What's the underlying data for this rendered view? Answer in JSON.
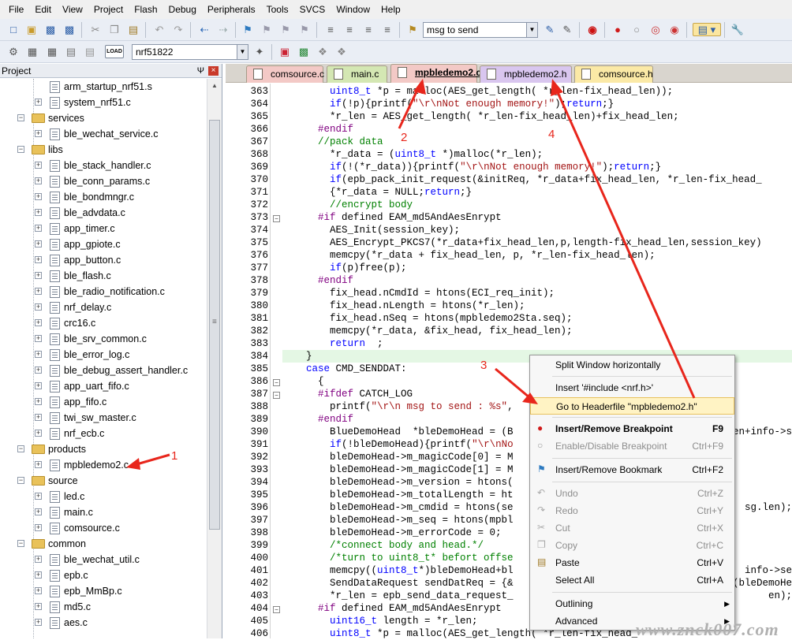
{
  "menu": [
    "File",
    "Edit",
    "View",
    "Project",
    "Flash",
    "Debug",
    "Peripherals",
    "Tools",
    "SVCS",
    "Window",
    "Help"
  ],
  "toolbar": {
    "find_combo_value": "msg to send",
    "target_combo_value": "nrf51822",
    "load_label": "LOAD"
  },
  "project_panel": {
    "title": "Project",
    "pin_glyph": "Ψ",
    "close_glyph": "×",
    "items": [
      {
        "label": "arm_startup_nrf51.s",
        "type": "file",
        "level": 2,
        "expand": ""
      },
      {
        "label": "system_nrf51.c",
        "type": "file",
        "level": 2,
        "expand": "+"
      },
      {
        "label": "services",
        "type": "folder",
        "level": 1,
        "expand": "−"
      },
      {
        "label": "ble_wechat_service.c",
        "type": "file",
        "level": 2,
        "expand": "+"
      },
      {
        "label": "libs",
        "type": "folder",
        "level": 1,
        "expand": "−"
      },
      {
        "label": "ble_stack_handler.c",
        "type": "file",
        "level": 2,
        "expand": "+"
      },
      {
        "label": "ble_conn_params.c",
        "type": "file",
        "level": 2,
        "expand": "+"
      },
      {
        "label": "ble_bondmngr.c",
        "type": "file",
        "level": 2,
        "expand": "+"
      },
      {
        "label": "ble_advdata.c",
        "type": "file",
        "level": 2,
        "expand": "+"
      },
      {
        "label": "app_timer.c",
        "type": "file",
        "level": 2,
        "expand": "+"
      },
      {
        "label": "app_gpiote.c",
        "type": "file",
        "level": 2,
        "expand": "+"
      },
      {
        "label": "app_button.c",
        "type": "file",
        "level": 2,
        "expand": "+"
      },
      {
        "label": "ble_flash.c",
        "type": "file",
        "level": 2,
        "expand": "+"
      },
      {
        "label": "ble_radio_notification.c",
        "type": "file",
        "level": 2,
        "expand": "+"
      },
      {
        "label": "nrf_delay.c",
        "type": "file",
        "level": 2,
        "expand": "+"
      },
      {
        "label": "crc16.c",
        "type": "file",
        "level": 2,
        "expand": "+"
      },
      {
        "label": "ble_srv_common.c",
        "type": "file",
        "level": 2,
        "expand": "+"
      },
      {
        "label": "ble_error_log.c",
        "type": "file",
        "level": 2,
        "expand": "+"
      },
      {
        "label": "ble_debug_assert_handler.c",
        "type": "file",
        "level": 2,
        "expand": "+"
      },
      {
        "label": "app_uart_fifo.c",
        "type": "file",
        "level": 2,
        "expand": "+"
      },
      {
        "label": "app_fifo.c",
        "type": "file",
        "level": 2,
        "expand": "+"
      },
      {
        "label": "twi_sw_master.c",
        "type": "file",
        "level": 2,
        "expand": "+"
      },
      {
        "label": "nrf_ecb.c",
        "type": "file",
        "level": 2,
        "expand": "+"
      },
      {
        "label": "products",
        "type": "folder",
        "level": 1,
        "expand": "−"
      },
      {
        "label": "mpbledemo2.c",
        "type": "file",
        "level": 2,
        "expand": "+"
      },
      {
        "label": "source",
        "type": "folder",
        "level": 1,
        "expand": "−"
      },
      {
        "label": "led.c",
        "type": "file",
        "level": 2,
        "expand": "+"
      },
      {
        "label": "main.c",
        "type": "file",
        "level": 2,
        "expand": "+"
      },
      {
        "label": "comsource.c",
        "type": "file",
        "level": 2,
        "expand": "+"
      },
      {
        "label": "common",
        "type": "folder",
        "level": 1,
        "expand": "−"
      },
      {
        "label": "ble_wechat_util.c",
        "type": "file",
        "level": 2,
        "expand": "+"
      },
      {
        "label": "epb.c",
        "type": "file",
        "level": 2,
        "expand": "+"
      },
      {
        "label": "epb_MmBp.c",
        "type": "file",
        "level": 2,
        "expand": "+"
      },
      {
        "label": "md5.c",
        "type": "file",
        "level": 2,
        "expand": "+"
      },
      {
        "label": "aes.c",
        "type": "file",
        "level": 2,
        "expand": "+"
      }
    ]
  },
  "tabs": [
    {
      "label": "comsource.c",
      "color": "#f3c9c6",
      "active": false
    },
    {
      "label": "main.c",
      "color": "#d4e7b3",
      "active": false
    },
    {
      "label": "mpbledemo2.c",
      "color": "#f3c9c6",
      "active": true
    },
    {
      "label": "mpbledemo2.h",
      "color": "#d9c6ef",
      "active": false
    },
    {
      "label": "comsource.h",
      "color": "#fbe9a6",
      "active": false
    }
  ],
  "code": {
    "line_numbers": [
      "363",
      "364",
      "365",
      "366",
      "367",
      "368",
      "369",
      "370",
      "371",
      "372",
      "373",
      "374",
      "375",
      "376",
      "377",
      "378",
      "379",
      "380",
      "381",
      "382",
      "383",
      "384",
      "385",
      "386",
      "387",
      "388",
      "389",
      "390",
      "391",
      "392",
      "393",
      "394",
      "395",
      "396",
      "397",
      "398",
      "399",
      "400",
      "401",
      "402",
      "403",
      "404",
      "405",
      "406"
    ],
    "lines": [
      "        uint8_t *p = malloc(AES_get_length( *r_len-fix_head_len));",
      "        if(!p){printf(\"\\r\\nNot enough memory!\");return;}",
      "        *r_len = AES_get_length( *r_len-fix_head_len)+fix_head_len;",
      "      #endif",
      "      //pack data",
      "        *r_data = (uint8_t *)malloc(*r_len);",
      "        if(!(*r_data)){printf(\"\\r\\nNot enough memory!\");return;}",
      "        if(epb_pack_init_request(&initReq, *r_data+fix_head_len, *r_len-fix_head_",
      "        {*r_data = NULL;return;}",
      "        //encrypt body",
      "      #if defined EAM_md5AndAesEnrypt",
      "        AES_Init(session_key);",
      "        AES_Encrypt_PKCS7(*r_data+fix_head_len,p,length-fix_head_len,session_key)",
      "        memcpy(*r_data + fix_head_len, p, *r_len-fix_head_len);",
      "        if(p)free(p);",
      "      #endif",
      "        fix_head.nCmdId = htons(ECI_req_init);",
      "        fix_head.nLength = htons(*r_len);",
      "        fix_head.nSeq = htons(mpbledemo2Sta.seq);",
      "        memcpy(*r_data, &fix_head, fix_head_len);",
      "        return  ;",
      "    }",
      "    case CMD_SENDDAT:",
      "      {",
      "      #ifdef CATCH_LOG",
      "        printf(\"\\r\\n msg to send : %s\",",
      "      #endif",
      "        BlueDemoHead  *bleDemoHead = (B",
      "        if(!bleDemoHead){printf(\"\\r\\nNo",
      "        bleDemoHead->m_magicCode[0] = M",
      "        bleDemoHead->m_magicCode[1] = M",
      "        bleDemoHead->m_version = htons(",
      "        bleDemoHead->m_totalLength = ht",
      "        bleDemoHead->m_cmdid = htons(se",
      "        bleDemoHead->m_seq = htons(mpbl",
      "        bleDemoHead->m_errorCode = 0;",
      "        /*connect body and head.*/",
      "        /*turn to uint8_t* befort offse",
      "        memcpy((uint8_t*)bleDemoHead+bl",
      "        SendDataRequest sendDatReq = {&",
      "        *r_len = epb_send_data_request_",
      "      #if defined EAM_md5AndAesEnrypt",
      "        uint16_t length = *r_len;",
      "        uint8_t *p = malloc(AES_get_length( *r_len-fix_head_"
    ],
    "right_fragments": [
      {
        "line_index": 27,
        "text": "en+info->s"
      },
      {
        "line_index": 33,
        "text": "sg.len);"
      },
      {
        "line_index": 38,
        "text": "info->se"
      },
      {
        "line_index": 39,
        "text": "(bleDemoHe"
      },
      {
        "line_index": 40,
        "text": "en);"
      }
    ]
  },
  "context_menu": {
    "items": [
      {
        "label": "Split Window horizontally",
        "shortcut": "",
        "state": "normal",
        "icon": ""
      },
      {
        "label": "Insert '#include <nrf.h>'",
        "shortcut": "",
        "state": "normal",
        "icon": ""
      },
      {
        "label": "Go to Headerfile \"mpbledemo2.h\"",
        "shortcut": "",
        "state": "selected",
        "icon": ""
      },
      {
        "label": "Insert/Remove Breakpoint",
        "shortcut": "F9",
        "state": "bold",
        "icon": "breakpoint-icon"
      },
      {
        "label": "Enable/Disable Breakpoint",
        "shortcut": "Ctrl+F9",
        "state": "disabled",
        "icon": "breakpoint-disabled-icon"
      },
      {
        "label": "Insert/Remove Bookmark",
        "shortcut": "Ctrl+F2",
        "state": "normal",
        "icon": "bookmark-icon"
      },
      {
        "label": "Undo",
        "shortcut": "Ctrl+Z",
        "state": "disabled",
        "icon": "undo-icon"
      },
      {
        "label": "Redo",
        "shortcut": "Ctrl+Y",
        "state": "disabled",
        "icon": "redo-icon"
      },
      {
        "label": "Cut",
        "shortcut": "Ctrl+X",
        "state": "disabled",
        "icon": "cut-icon"
      },
      {
        "label": "Copy",
        "shortcut": "Ctrl+C",
        "state": "disabled",
        "icon": "copy-icon"
      },
      {
        "label": "Paste",
        "shortcut": "Ctrl+V",
        "state": "normal",
        "icon": "paste-icon"
      },
      {
        "label": "Select All",
        "shortcut": "Ctrl+A",
        "state": "normal",
        "icon": ""
      },
      {
        "label": "Outlining",
        "shortcut": "",
        "state": "submenu",
        "icon": ""
      },
      {
        "label": "Advanced",
        "shortcut": "",
        "state": "submenu",
        "icon": ""
      }
    ]
  },
  "annotations": {
    "step_labels": [
      "1",
      "2",
      "3",
      "4"
    ],
    "arrow_color": "#e8261c"
  },
  "watermark": "www.znck007.com"
}
